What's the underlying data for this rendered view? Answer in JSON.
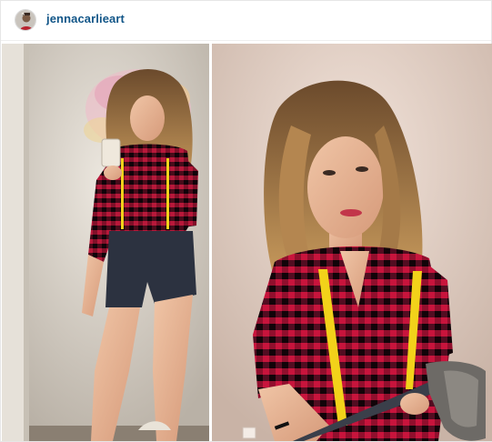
{
  "post": {
    "username": "jennacarlieart",
    "avatar_icon": "profile-avatar",
    "photo_left_icon": "mirror-selfie-photo",
    "photo_right_icon": "portrait-photo-with-axe"
  },
  "colors": {
    "username": "#125688",
    "plaid_red": "#c8143c",
    "plaid_dark": "#1a0a14",
    "suspenders": "#f2d21a",
    "wall_left": "#d9d2c7",
    "wall_right": "#e9d8cf"
  }
}
